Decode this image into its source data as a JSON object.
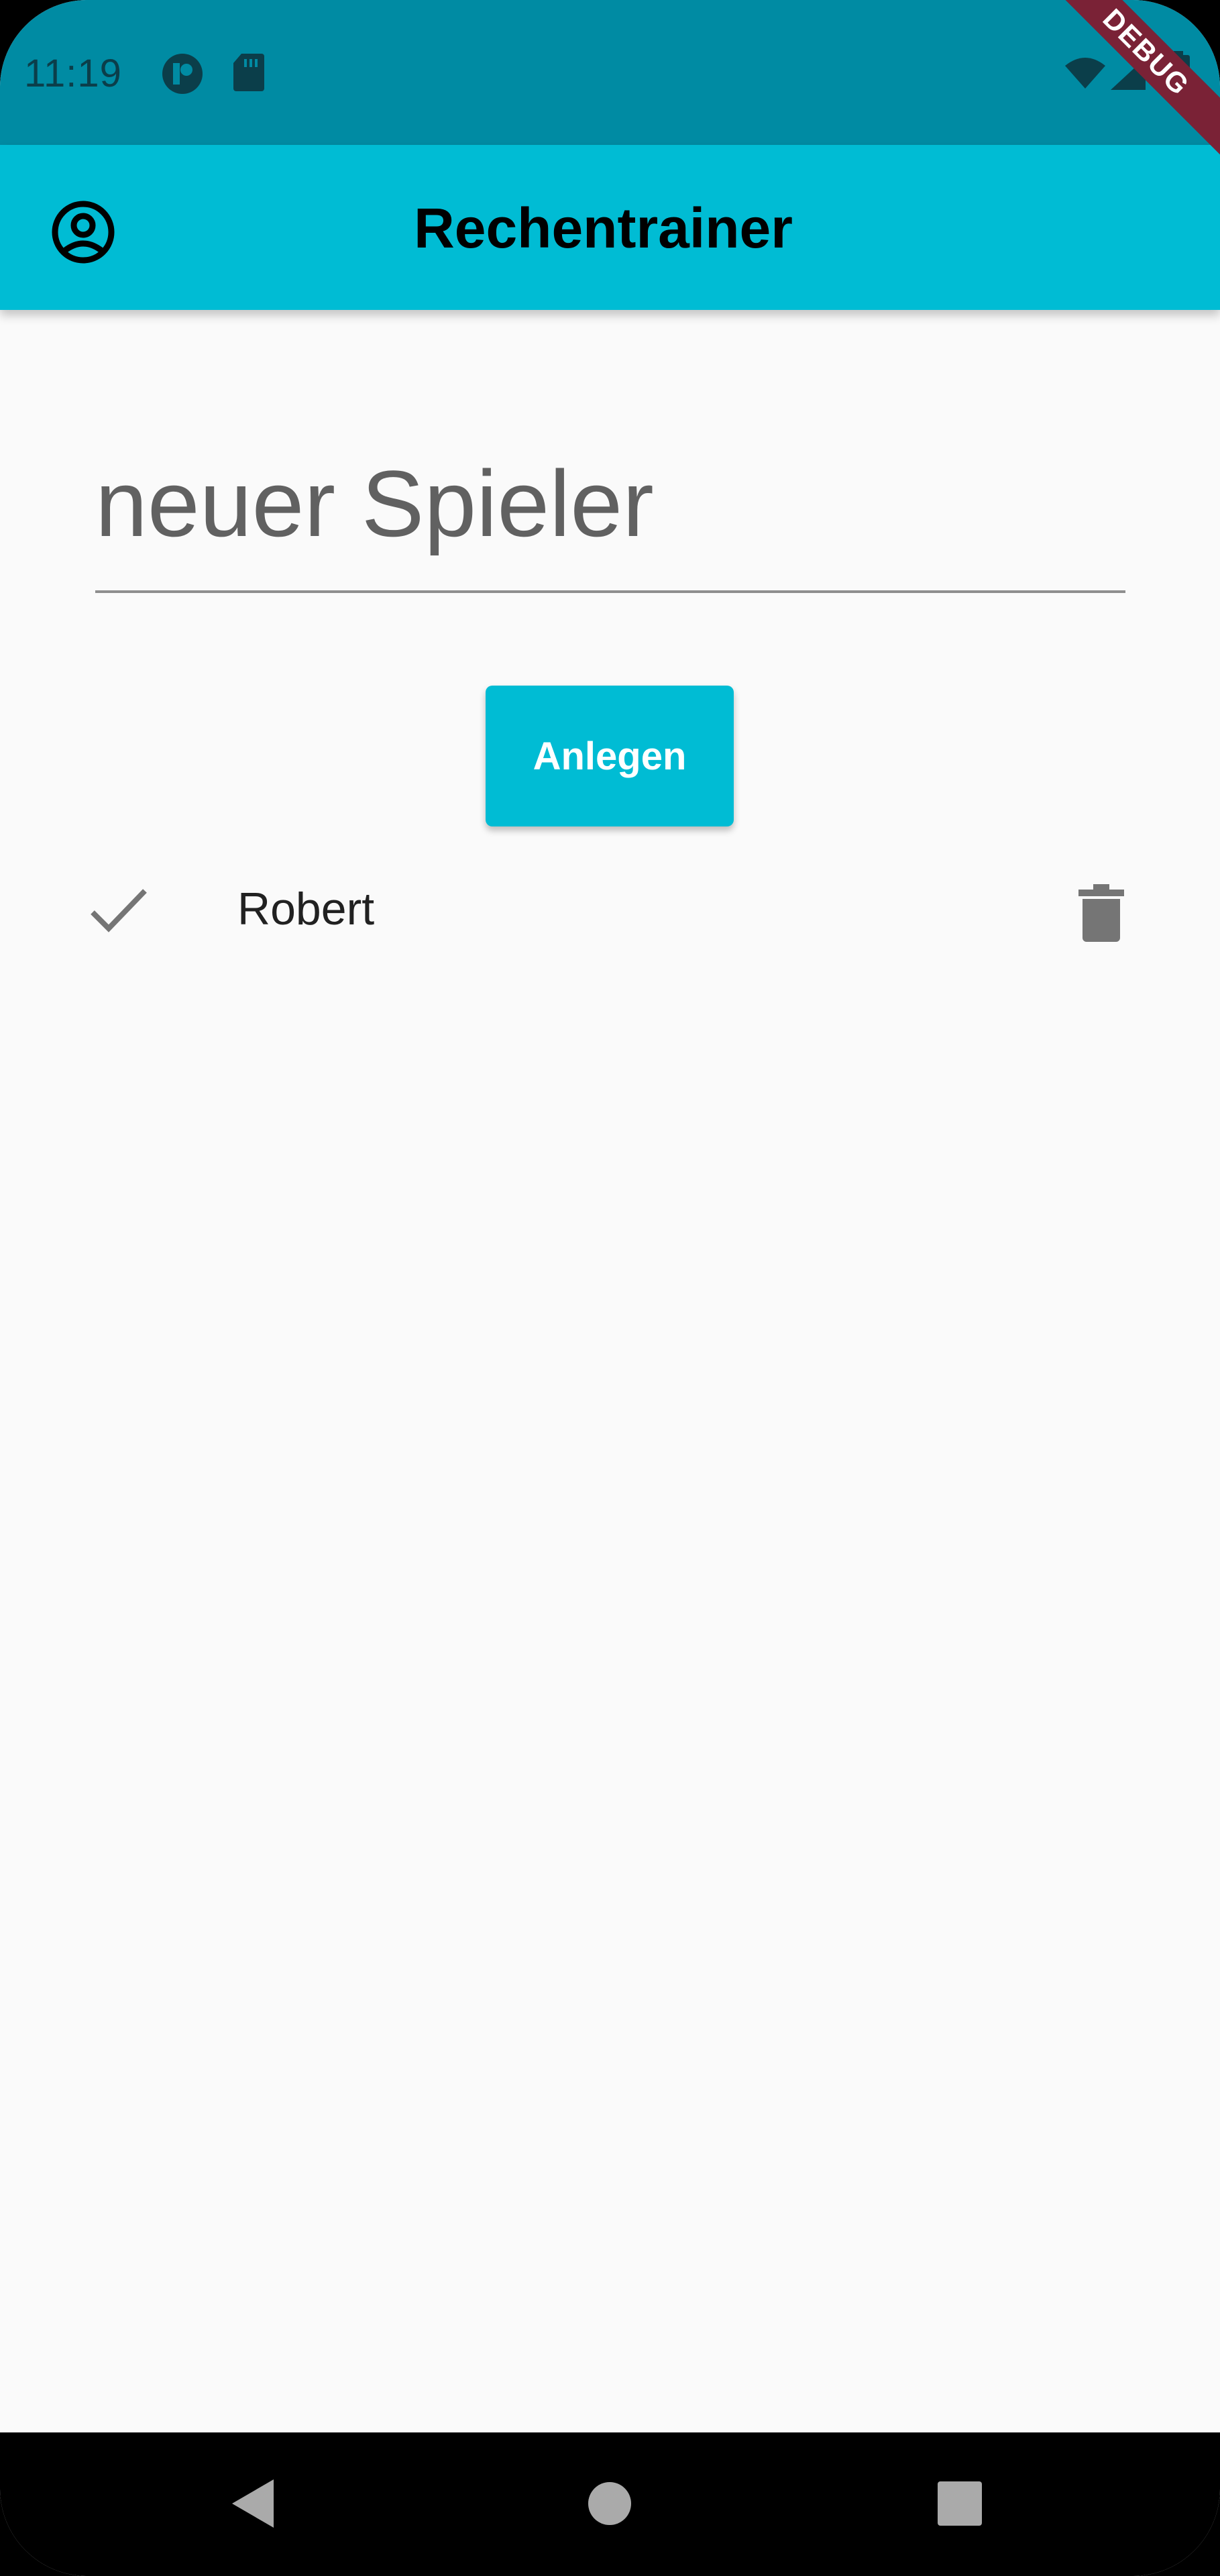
{
  "status_bar": {
    "time": "11:19",
    "icons": [
      "app-notification-icon",
      "sd-card-icon",
      "wifi-icon",
      "signal-icon",
      "battery-icon"
    ]
  },
  "debug_banner": {
    "label": "DEBUG"
  },
  "app_bar": {
    "title": "Rechentrainer",
    "leading_icon": "account-circle-icon",
    "color": "#00BCD4"
  },
  "form": {
    "new_player_placeholder": "neuer Spieler",
    "new_player_value": "",
    "create_button_label": "Anlegen"
  },
  "players": [
    {
      "name": "Robert",
      "selected": true,
      "leading_icon": "check-icon",
      "trailing_icon": "trash-icon"
    }
  ],
  "nav_bar": {
    "buttons": [
      "back-icon",
      "home-icon",
      "recents-icon"
    ]
  },
  "colors": {
    "status_bar": "#008BA3",
    "primary": "#00BCD4",
    "background": "#FAFAFA",
    "debug_banner": "#7A2236"
  }
}
